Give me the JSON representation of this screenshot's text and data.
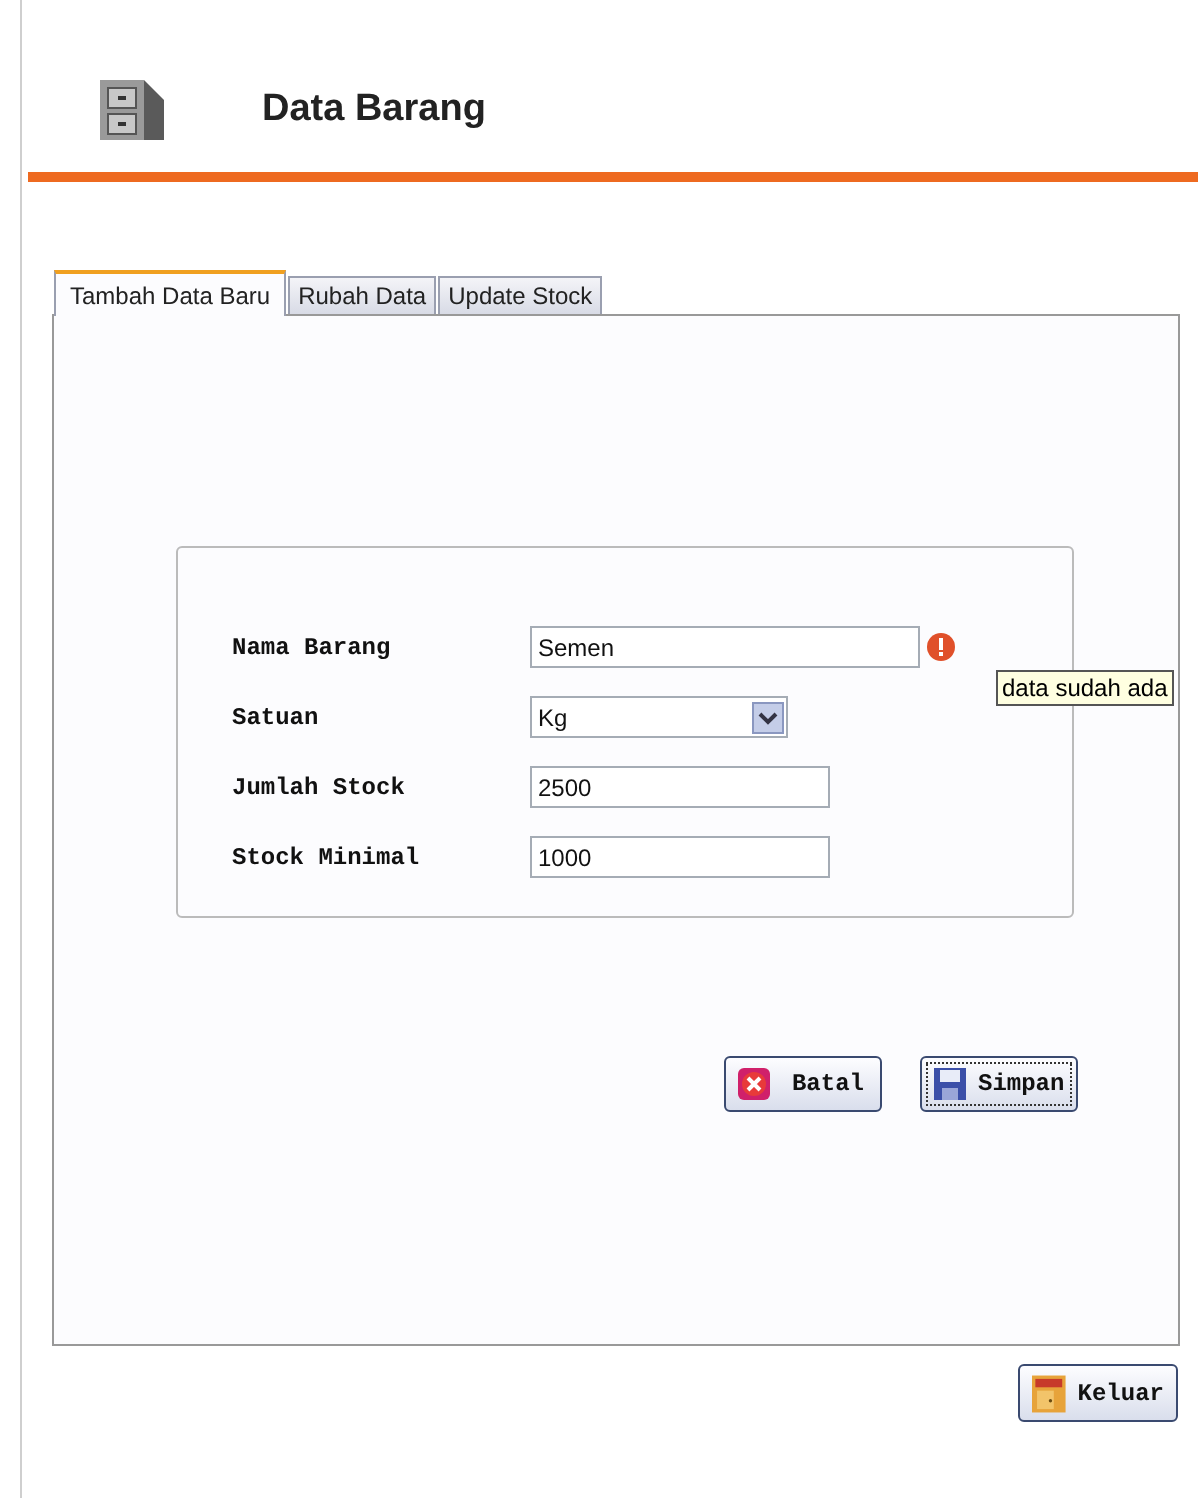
{
  "header": {
    "title": "Data Barang"
  },
  "tabs": [
    {
      "label": "Tambah Data Baru",
      "selected": true
    },
    {
      "label": "Rubah Data",
      "selected": false
    },
    {
      "label": "Update Stock",
      "selected": false
    }
  ],
  "form": {
    "fields": [
      {
        "label": "Nama Barang",
        "kind": "text",
        "value": "Semen",
        "error": "data sudah ada"
      },
      {
        "label": "Satuan",
        "kind": "select",
        "value": "Kg"
      },
      {
        "label": "Jumlah Stock",
        "kind": "text",
        "value": "2500"
      },
      {
        "label": "Stock Minimal",
        "kind": "text",
        "value": "1000"
      }
    ]
  },
  "buttons": [
    {
      "label": "Batal",
      "kind": "cancel",
      "focused": false
    },
    {
      "label": "Simpan",
      "kind": "save",
      "focused": true
    }
  ],
  "exit_button": {
    "label": "Keluar"
  }
}
